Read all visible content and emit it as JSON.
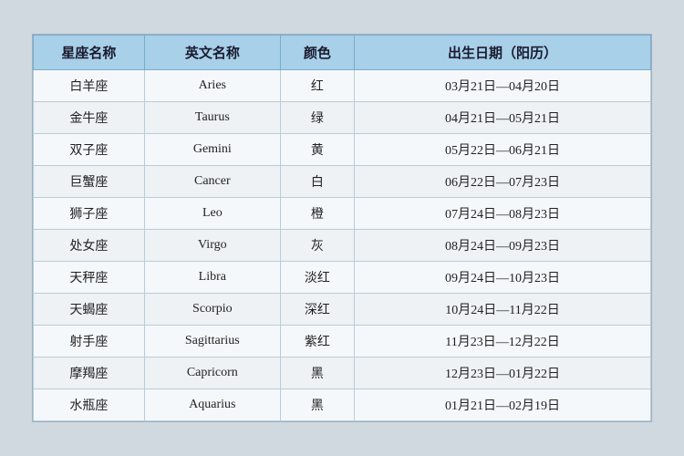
{
  "table": {
    "headers": [
      "星座名称",
      "英文名称",
      "颜色",
      "出生日期（阳历）"
    ],
    "rows": [
      {
        "name": "白羊座",
        "english": "Aries",
        "color": "红",
        "date": "03月21日—04月20日"
      },
      {
        "name": "金牛座",
        "english": "Taurus",
        "color": "绿",
        "date": "04月21日—05月21日"
      },
      {
        "name": "双子座",
        "english": "Gemini",
        "color": "黄",
        "date": "05月22日—06月21日"
      },
      {
        "name": "巨蟹座",
        "english": "Cancer",
        "color": "白",
        "date": "06月22日—07月23日"
      },
      {
        "name": "狮子座",
        "english": "Leo",
        "color": "橙",
        "date": "07月24日—08月23日"
      },
      {
        "name": "处女座",
        "english": "Virgo",
        "color": "灰",
        "date": "08月24日—09月23日"
      },
      {
        "name": "天秤座",
        "english": "Libra",
        "color": "淡红",
        "date": "09月24日—10月23日"
      },
      {
        "name": "天蝎座",
        "english": "Scorpio",
        "color": "深红",
        "date": "10月24日—11月22日"
      },
      {
        "name": "射手座",
        "english": "Sagittarius",
        "color": "紫红",
        "date": "11月23日—12月22日"
      },
      {
        "name": "摩羯座",
        "english": "Capricorn",
        "color": "黑",
        "date": "12月23日—01月22日"
      },
      {
        "name": "水瓶座",
        "english": "Aquarius",
        "color": "黑",
        "date": "01月21日—02月19日"
      }
    ]
  }
}
